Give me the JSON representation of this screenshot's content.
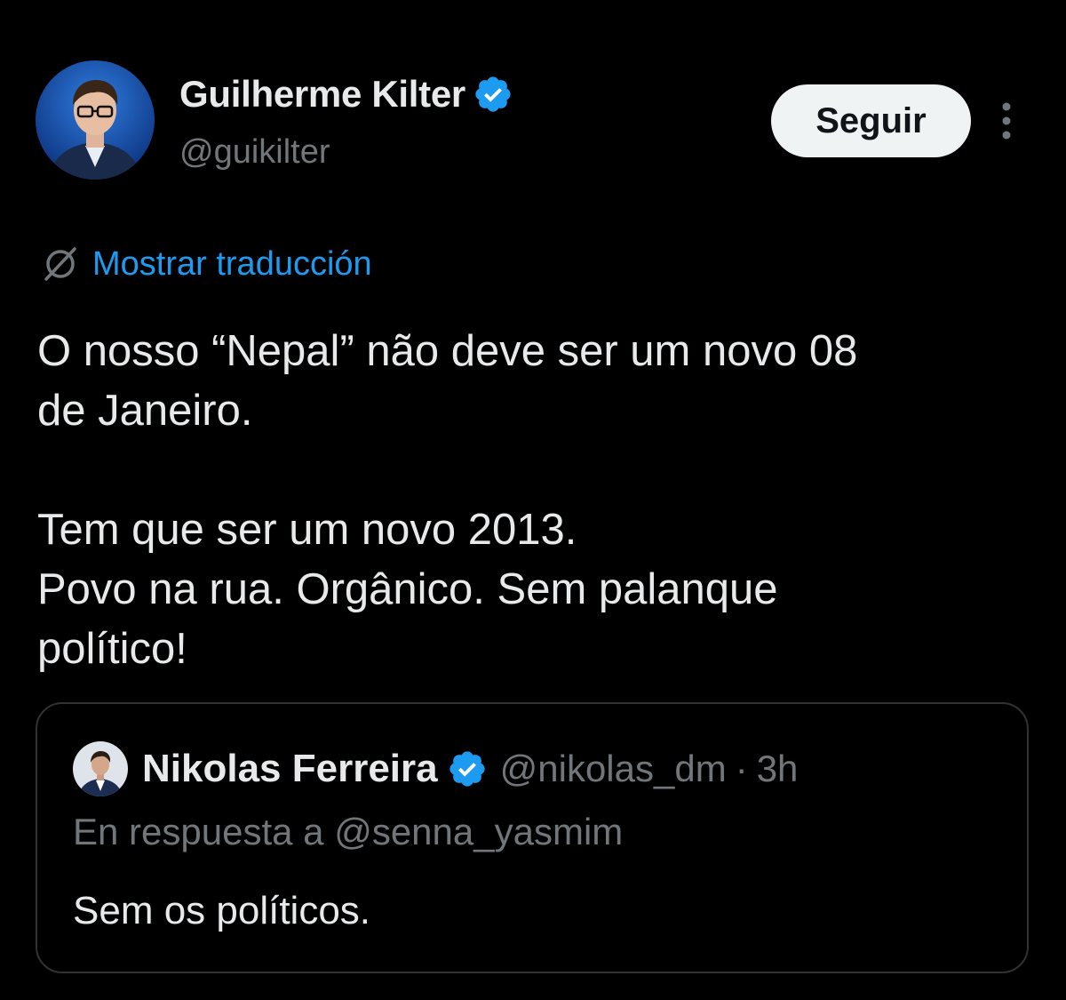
{
  "author": {
    "name": "Guilherme Kilter",
    "handle": "@guikilter",
    "avatar_icon": "user-avatar-photo",
    "verified_icon": "verified-badge-icon"
  },
  "actions": {
    "follow_label": "Seguir",
    "more_icon": "more-vertical-icon"
  },
  "translate": {
    "icon": "translate-globe-icon",
    "label": "Mostrar traducción"
  },
  "tweet": {
    "line1": "O nosso “Nepal” não deve ser um novo 08",
    "line2": "de Janeiro.",
    "line3": "Tem que ser um novo 2013.",
    "line4": "Povo na rua. Orgânico. Sem palanque",
    "line5": "político!"
  },
  "quoted": {
    "name": "Nikolas Ferreira",
    "handle": "@nikolas_dm",
    "separator": "·",
    "time": "3h",
    "reply_prefix": "En respuesta a",
    "reply_mention": "@senna_yasmim",
    "text": "Sem os políticos."
  },
  "colors": {
    "background": "#000000",
    "primary_text": "#e7e9ea",
    "secondary_text": "#71767b",
    "link": "#1d9bf0",
    "verified": "#1d9bf0",
    "follow_bg": "#eff3f4",
    "border": "#2f3336"
  }
}
